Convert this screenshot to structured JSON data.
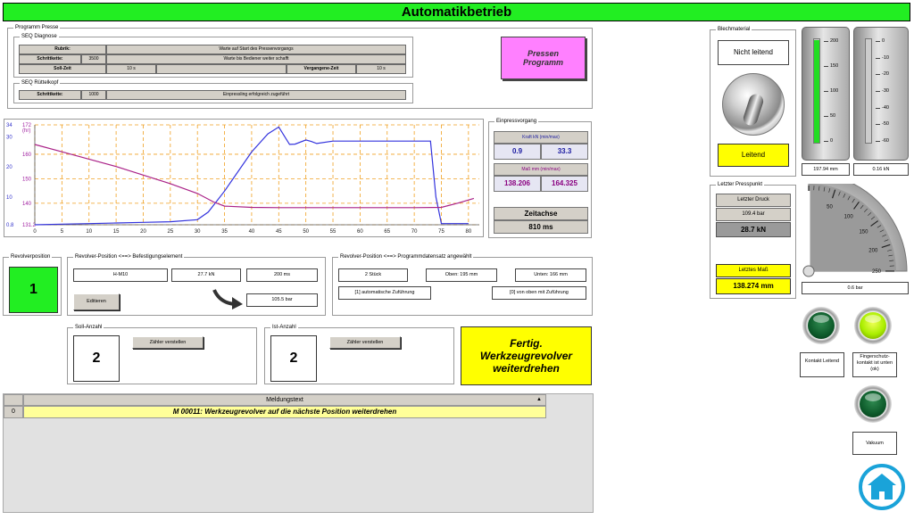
{
  "title": "Automatikbetrieb",
  "programm": {
    "group_label": "Programm Presse",
    "seq_diagnose": {
      "label": "SEQ Diagnose",
      "rubrik_label": "Rubrik:",
      "rubrik_value": "Warte auf Start des Pressenvorgangs",
      "schrittkette_label": "Schrittkette:",
      "schrittkette_num": "3500",
      "schrittkette_text": "Warte bis Bediener weiter schafft",
      "sollzeit_label": "Soll-Zeit",
      "sollzeit_value": "10 s",
      "vergangen_label": "Vergangene-Zeit",
      "vergangen_value": "10 s"
    },
    "seq_ruettel": {
      "label": "SEQ Rüttelkopf",
      "schrittkette_label": "Schrittkette:",
      "schrittkette_num": "1000",
      "schrittkette_text": "Einpressling erfolgreich zugeführt"
    },
    "pressen_button": "Pressen Programm"
  },
  "chart_data": {
    "type": "line",
    "x_ticks": [
      "0",
      "5",
      "10",
      "15",
      "20",
      "25",
      "30",
      "35",
      "40",
      "45",
      "50",
      "55",
      "60",
      "65",
      "70",
      "75",
      "80"
    ],
    "xlim": [
      0,
      82
    ],
    "left_axis": {
      "labels": [
        "34",
        "30",
        "20",
        "10",
        "0.8"
      ],
      "values": [
        34,
        30,
        20,
        10,
        0.8
      ],
      "ylim": [
        0.8,
        34
      ],
      "color": "#3333cc"
    },
    "right_axis": {
      "labels": [
        "172",
        "(hr)",
        "160",
        "150",
        "140",
        "131.2"
      ],
      "values": [
        172,
        160,
        150,
        140,
        131.2
      ],
      "ylim": [
        131.2,
        172
      ],
      "color": "#a020a0"
    },
    "series": [
      {
        "color": "#3333dd",
        "axis": "left",
        "x": [
          0,
          5,
          10,
          15,
          20,
          25,
          30,
          32,
          35,
          40,
          43,
          45,
          47,
          48,
          50,
          51,
          52,
          55,
          60,
          65,
          70,
          73,
          74,
          75,
          80
        ],
        "y": [
          0.8,
          1.0,
          1.2,
          1.4,
          1.6,
          1.8,
          2.5,
          5,
          12,
          25,
          31,
          33.3,
          27.5,
          27.6,
          29,
          28.5,
          27.8,
          28.6,
          28.6,
          28.6,
          28.6,
          28.6,
          10,
          1.2,
          1.2
        ]
      },
      {
        "color": "#aa2288",
        "axis": "right",
        "x": [
          0,
          5,
          10,
          15,
          20,
          25,
          30,
          33,
          35,
          40,
          45,
          50,
          55,
          60,
          65,
          70,
          75,
          78,
          81
        ],
        "y": [
          164,
          161,
          158,
          155,
          151.5,
          148,
          144,
          140.5,
          138.8,
          138.3,
          138.2,
          138.2,
          138.2,
          138.2,
          138.2,
          138.2,
          138.3,
          140,
          142
        ]
      }
    ]
  },
  "einpress": {
    "label": "Einpressvorgang",
    "kraft_label": "Kraft kN (min/max)",
    "kraft_min": "0.9",
    "kraft_max": "33.3",
    "mass_label": "Maß mm (min/max)",
    "mass_min": "138.206",
    "mass_max": "164.325",
    "zeitachse_label": "Zeitachse",
    "zeitachse_value": "810 ms"
  },
  "revolverposition": {
    "label": "Revolverposition",
    "value": "1"
  },
  "befestigung": {
    "label": "Revolver-Position <==> Befestigungselement",
    "element": "H-M10",
    "kraft": "27.7 kN",
    "zeit": "200 ms",
    "druck": "105.5 bar",
    "edit_button": "Editieren"
  },
  "programmdatensatz": {
    "label": "Revolver-Position <==> Programmdatensatz angewählt",
    "stueck": "2 Stück",
    "oben": "Oben: 195 mm",
    "unten": "Unten: 166 mm",
    "auto": "[1] automatische Zuführung",
    "oben_mit": "[0] von oben mit Zuführung"
  },
  "soll_anzahl": {
    "label": "Soll-Anzahl",
    "value": "2",
    "button": "Zähler verstellen"
  },
  "ist_anzahl": {
    "label": "Ist-Anzahl",
    "value": "2",
    "button": "Zähler verstellen"
  },
  "fertig_message": "Fertig. Werkzeugrevolver weiterdrehen",
  "meldungen": {
    "header": "Meldungstext",
    "rows": [
      {
        "index": "0",
        "text": "M 00011: Werkzeugrevolver auf die nächste Position weiterdrehen"
      }
    ]
  },
  "blechmaterial": {
    "label": "Blechmaterial",
    "status": "Nicht leitend",
    "indicator": "Leitend"
  },
  "gauge_left": {
    "ticks": [
      "200",
      "150",
      "100",
      "50",
      "0"
    ],
    "fill_fraction": 0.99,
    "value": "197.94 mm"
  },
  "gauge_right": {
    "ticks": [
      "0",
      "-10",
      "-20",
      "-30",
      "-40",
      "-50",
      "-60"
    ],
    "fill_fraction": 0.0,
    "value": "0.16 kN"
  },
  "letzter_presspunkt": {
    "label": "Letzter Presspunkt",
    "druck_label": "Letzter Druck",
    "druck_bar": "109.4 bar",
    "druck_kn": "28.7 kN",
    "mass_label": "Letztes Maß",
    "mass_value": "138.274 mm"
  },
  "dial": {
    "ticks": [
      "50",
      "100",
      "150",
      "200",
      "250"
    ],
    "value": "0.6 bar",
    "fraction": 0.0
  },
  "leds": [
    {
      "label": "Kontakt Leitend",
      "color": "#0d5a2a"
    },
    {
      "label": "Fingerschutz-kontakt ist unten (ok)",
      "color": "#aaee00"
    },
    {
      "label": "Vakuum",
      "color": "#0d5a2a"
    }
  ],
  "colors": {
    "accent_green": "#22ee22",
    "pink": "#ff80ff",
    "yellow": "#ffff00",
    "home": "#1aa3d9"
  }
}
